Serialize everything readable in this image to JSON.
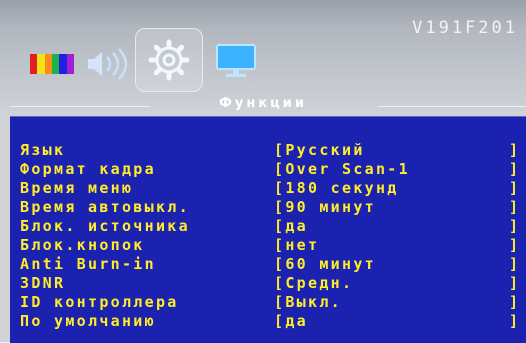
{
  "model": "V191F201",
  "colors": {
    "panel_bg": "#1b22b0",
    "item_text": "#ffec2a",
    "header_text": "#ffffff"
  },
  "tabs": [
    {
      "icon": "color-bars-icon",
      "active": false
    },
    {
      "icon": "speaker-icon",
      "active": false
    },
    {
      "icon": "gear-icon",
      "active": true
    },
    {
      "icon": "monitor-icon",
      "active": false
    }
  ],
  "section_title": "Функции",
  "menu": [
    {
      "label": "Язык",
      "value": "[Русский"
    },
    {
      "label": "Формат кадра",
      "value": "[Over Scan-1"
    },
    {
      "label": "Время меню",
      "value": "[180 секунд"
    },
    {
      "label": "Время автовыкл.",
      "value": "[90 минут"
    },
    {
      "label": "Блок. источника",
      "value": "[да"
    },
    {
      "label": "Блок.кнопок",
      "value": "[нет"
    },
    {
      "label": "Anti Burn-in",
      "value": "[60 минут"
    },
    {
      "label": "3DNR",
      "value": "[Средн."
    },
    {
      "label": "ID контроллера",
      "value": "[Выкл."
    },
    {
      "label": "По умолчанию",
      "value": "[да"
    }
  ],
  "row_end_bracket": "]"
}
